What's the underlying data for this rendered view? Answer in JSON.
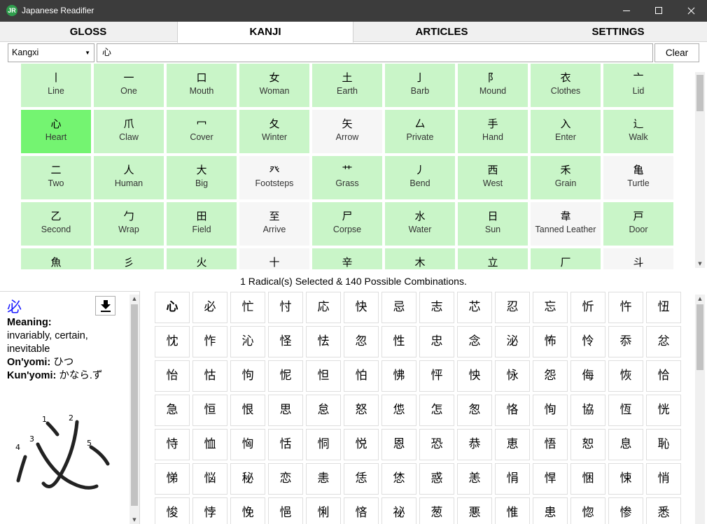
{
  "window": {
    "title": "Japanese Readifier",
    "icon_text": "JR"
  },
  "tabs": [
    {
      "label": "GLOSS",
      "active": false
    },
    {
      "label": "KANJI",
      "active": true
    },
    {
      "label": "ARTICLES",
      "active": false
    },
    {
      "label": "SETTINGS",
      "active": false
    }
  ],
  "search": {
    "dropdown_value": "Kangxi",
    "query": "心",
    "clear_label": "Clear"
  },
  "radicals": [
    {
      "k": "丨",
      "n": "Line",
      "state": "available"
    },
    {
      "k": "一",
      "n": "One",
      "state": "available"
    },
    {
      "k": "口",
      "n": "Mouth",
      "state": "available"
    },
    {
      "k": "女",
      "n": "Woman",
      "state": "available"
    },
    {
      "k": "土",
      "n": "Earth",
      "state": "available"
    },
    {
      "k": "亅",
      "n": "Barb",
      "state": "available"
    },
    {
      "k": "阝",
      "n": "Mound",
      "state": "available"
    },
    {
      "k": "衣",
      "n": "Clothes",
      "state": "available"
    },
    {
      "k": "亠",
      "n": "Lid",
      "state": "available"
    },
    {
      "k": "心",
      "n": "Heart",
      "state": "selected"
    },
    {
      "k": "爪",
      "n": "Claw",
      "state": "available"
    },
    {
      "k": "冖",
      "n": "Cover",
      "state": "available"
    },
    {
      "k": "夂",
      "n": "Winter",
      "state": "available"
    },
    {
      "k": "矢",
      "n": "Arrow",
      "state": "disabled"
    },
    {
      "k": "厶",
      "n": "Private",
      "state": "available"
    },
    {
      "k": "手",
      "n": "Hand",
      "state": "available"
    },
    {
      "k": "入",
      "n": "Enter",
      "state": "available"
    },
    {
      "k": "辶",
      "n": "Walk",
      "state": "available"
    },
    {
      "k": "二",
      "n": "Two",
      "state": "available"
    },
    {
      "k": "人",
      "n": "Human",
      "state": "available"
    },
    {
      "k": "大",
      "n": "Big",
      "state": "available"
    },
    {
      "k": "癶",
      "n": "Footsteps",
      "state": "disabled"
    },
    {
      "k": "艹",
      "n": "Grass",
      "state": "available"
    },
    {
      "k": "丿",
      "n": "Bend",
      "state": "available"
    },
    {
      "k": "西",
      "n": "West",
      "state": "available"
    },
    {
      "k": "禾",
      "n": "Grain",
      "state": "available"
    },
    {
      "k": "亀",
      "n": "Turtle",
      "state": "disabled"
    },
    {
      "k": "乙",
      "n": "Second",
      "state": "available"
    },
    {
      "k": "勹",
      "n": "Wrap",
      "state": "available"
    },
    {
      "k": "田",
      "n": "Field",
      "state": "available"
    },
    {
      "k": "至",
      "n": "Arrive",
      "state": "disabled"
    },
    {
      "k": "尸",
      "n": "Corpse",
      "state": "available"
    },
    {
      "k": "水",
      "n": "Water",
      "state": "available"
    },
    {
      "k": "日",
      "n": "Sun",
      "state": "available"
    },
    {
      "k": "韋",
      "n": "Tanned Leather",
      "state": "disabled"
    },
    {
      "k": "戸",
      "n": "Door",
      "state": "available"
    },
    {
      "k": "魚",
      "n": "",
      "state": "available"
    },
    {
      "k": "彡",
      "n": "",
      "state": "available"
    },
    {
      "k": "火",
      "n": "",
      "state": "available"
    },
    {
      "k": "十",
      "n": "",
      "state": "disabled"
    },
    {
      "k": "辛",
      "n": "",
      "state": "available"
    },
    {
      "k": "木",
      "n": "",
      "state": "available"
    },
    {
      "k": "立",
      "n": "",
      "state": "available"
    },
    {
      "k": "厂",
      "n": "",
      "state": "available"
    },
    {
      "k": "斗",
      "n": "",
      "state": "disabled"
    }
  ],
  "status_text": "1 Radical(s) Selected & 140 Possible Combinations.",
  "info": {
    "kanji": "必",
    "meaning_label": "Meaning:",
    "meaning": "invariably, certain, inevitable",
    "onyomi_label": "On'yomi:",
    "onyomi": "ひつ",
    "kunyomi_label": "Kun'yomi:",
    "kunyomi": "かなら.ず",
    "stroke_numbers": [
      "1",
      "2",
      "3",
      "4",
      "5"
    ]
  },
  "kanji_results": [
    "心",
    "必",
    "忙",
    "忖",
    "応",
    "快",
    "忌",
    "志",
    "芯",
    "忍",
    "忘",
    "忻",
    "忤",
    "忸",
    "忱",
    "怍",
    "沁",
    "怪",
    "怯",
    "忽",
    "性",
    "忠",
    "念",
    "泌",
    "怖",
    "怜",
    "忝",
    "忿",
    "怡",
    "怙",
    "怐",
    "怩",
    "怛",
    "怕",
    "怫",
    "怦",
    "怏",
    "怺",
    "怨",
    "侮",
    "恢",
    "恰",
    "急",
    "恒",
    "恨",
    "思",
    "怠",
    "怒",
    "怹",
    "怎",
    "怱",
    "恪",
    "恂",
    "協",
    "恆",
    "恍",
    "恃",
    "恤",
    "恟",
    "恬",
    "恫",
    "悦",
    "恩",
    "恐",
    "恭",
    "恵",
    "悟",
    "恕",
    "息",
    "恥",
    "悌",
    "悩",
    "秘",
    "恋",
    "恚",
    "恁",
    "恷",
    "惑",
    "恙",
    "悁",
    "悍",
    "悃",
    "悚",
    "悄",
    "悛",
    "悖",
    "悗",
    "悒",
    "悧",
    "悋",
    "祕",
    "葱",
    "悪",
    "惟",
    "患",
    "惚",
    "惨",
    "悉"
  ]
}
